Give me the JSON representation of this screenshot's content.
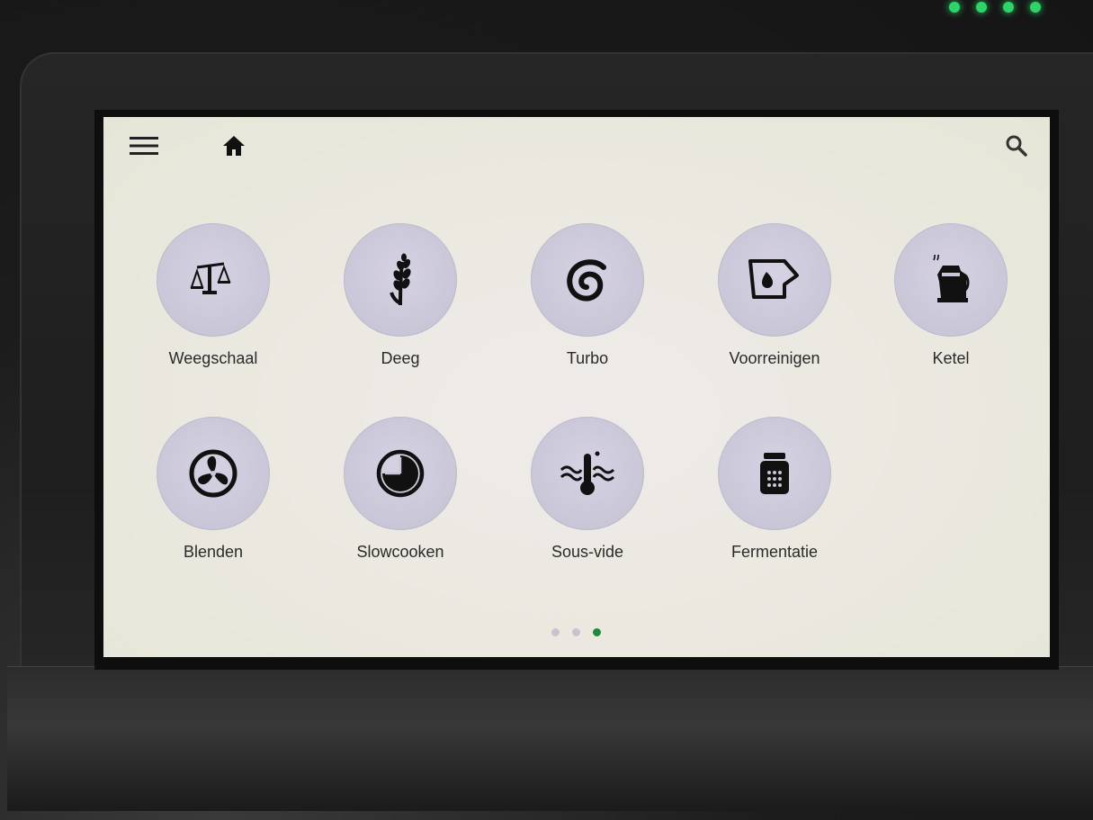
{
  "device": {
    "led_color": "#2ed36a",
    "led_count": 4
  },
  "topbar": {
    "menu_icon": "hamburger-menu-icon",
    "home_icon": "home-icon",
    "search_icon": "search-icon"
  },
  "tiles": [
    {
      "label": "Weegschaal",
      "icon": "scale-icon"
    },
    {
      "label": "Deeg",
      "icon": "wheat-icon"
    },
    {
      "label": "Turbo",
      "icon": "spiral-icon"
    },
    {
      "label": "Voorreinigen",
      "icon": "cup-drop-icon"
    },
    {
      "label": "Ketel",
      "icon": "kettle-icon"
    },
    {
      "label": "Blenden",
      "icon": "fan-blade-icon"
    },
    {
      "label": "Slowcooken",
      "icon": "clock-icon"
    },
    {
      "label": "Sous-vide",
      "icon": "thermometer-waves-icon"
    },
    {
      "label": "Fermentatie",
      "icon": "jar-icon"
    }
  ],
  "pager": {
    "page_count": 3,
    "current_page": 3,
    "active_color": "#1e8a3d"
  }
}
